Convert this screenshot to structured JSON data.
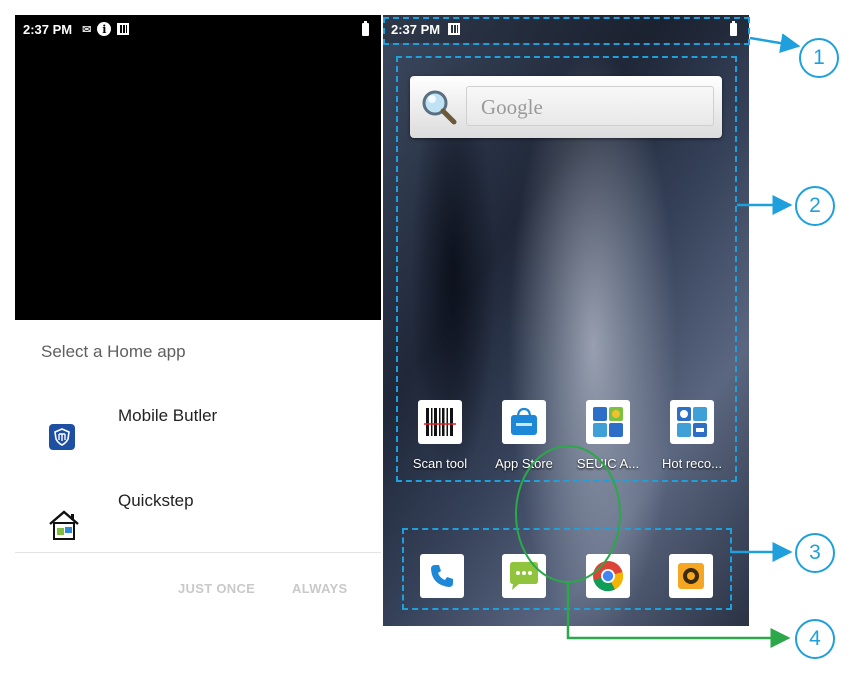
{
  "left_screen": {
    "status_time": "2:37 PM",
    "chooser_title": "Select a Home app",
    "apps": [
      {
        "label": "Mobile Butler",
        "icon": "shield-icon"
      },
      {
        "label": "Quickstep",
        "icon": "house-icon"
      }
    ],
    "button_once": "JUST ONCE",
    "button_always": "ALWAYS"
  },
  "right_screen": {
    "status_time": "2:37 PM",
    "search_placeholder": "Google",
    "apps": [
      {
        "label": "Scan tool",
        "icon": "barcode-icon"
      },
      {
        "label": "App Store",
        "icon": "store-bag-icon"
      },
      {
        "label": "SEUIC A...",
        "icon": "seuic-apps-icon"
      },
      {
        "label": "Hot reco...",
        "icon": "hot-recommend-icon"
      }
    ],
    "dock": [
      {
        "icon": "phone-icon"
      },
      {
        "icon": "messaging-icon"
      },
      {
        "icon": "chrome-icon"
      },
      {
        "icon": "camera-icon"
      }
    ]
  },
  "annotations": {
    "callouts": [
      "1",
      "2",
      "3",
      "4"
    ],
    "accent_color": "#1fa0dc",
    "circle_color": "#2aa84a"
  }
}
